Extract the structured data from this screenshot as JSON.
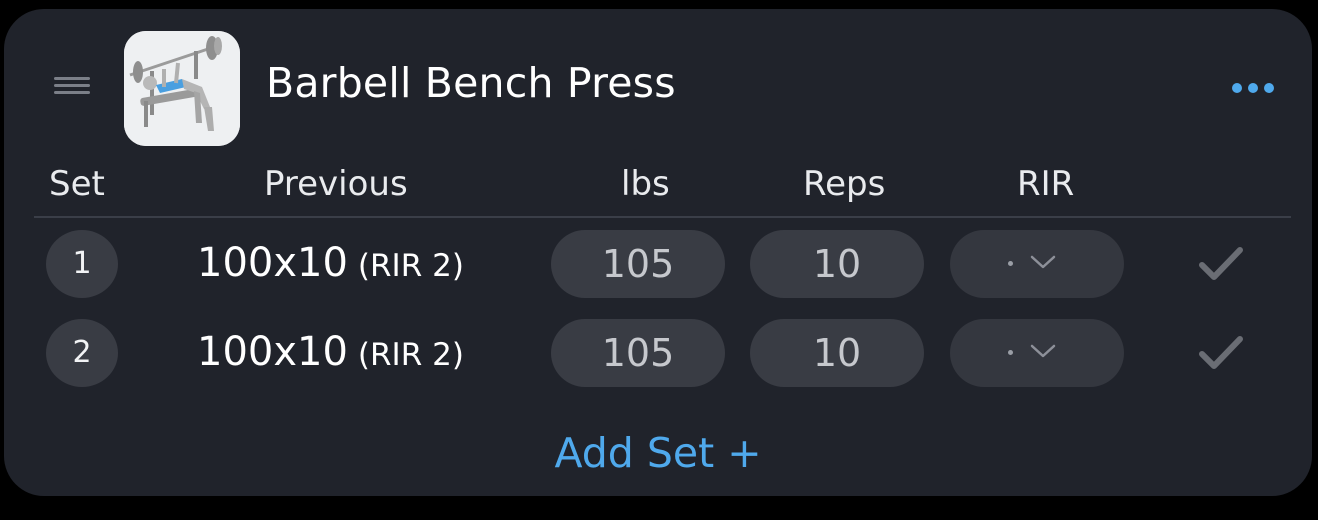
{
  "exercise": {
    "title": "Barbell Bench Press",
    "thumbnail_icon": "bench-press-figure-icon",
    "menu_icon": "more-horizontal-icon",
    "handle_icon": "drag-handle-icon"
  },
  "columns": {
    "set": "Set",
    "previous": "Previous",
    "weight": "lbs",
    "reps": "Reps",
    "rir": "RIR"
  },
  "sets": [
    {
      "number": "1",
      "previous_main": "100x10",
      "previous_rir": "(RIR 2)",
      "weight": "105",
      "reps": "10",
      "rir": "·",
      "completed": false
    },
    {
      "number": "2",
      "previous_main": "100x10",
      "previous_rir": "(RIR 2)",
      "weight": "105",
      "reps": "10",
      "rir": "·",
      "completed": false
    }
  ],
  "add_set_label": "Add Set +",
  "colors": {
    "card_bg": "#20232b",
    "accent": "#4fa9ec",
    "pill_bg": "#393c44",
    "check_inactive": "#6a6d74"
  }
}
